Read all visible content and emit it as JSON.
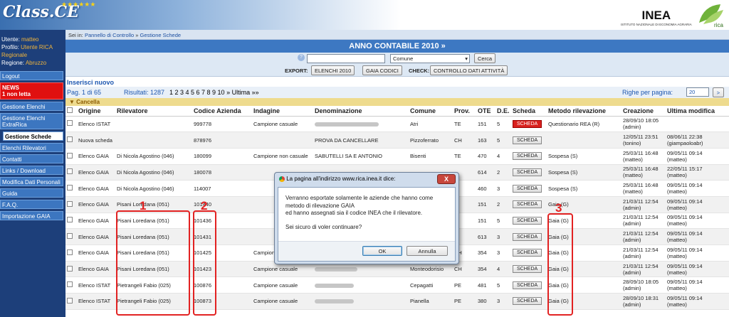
{
  "header": {
    "logo": "Class.CE",
    "inea": "INEA",
    "inea_sub": "ISTITUTO NAZIONALE DI ECONOMIA AGRARIA",
    "rica": "rica"
  },
  "user": {
    "utente_label": "Utente:",
    "utente": "matteo",
    "profilo_label": "Profilo:",
    "profilo": "Utente RICA Regionale",
    "regione_label": "Regione:",
    "regione": "Abruzzo"
  },
  "sidebar": {
    "logout": "Logout",
    "news": "NEWS",
    "news_count": "1 non letta",
    "items": [
      "Gestione Elenchi",
      "Gestione Elenchi ExtraRica",
      "Gestione Schede",
      "Elenchi Rilevatori",
      "Contatti",
      "Links / Download",
      "Modifica Dati Personali",
      "Guida",
      "F.A.Q.",
      "Importazione GAIA"
    ]
  },
  "breadcrumb": {
    "prefix": "Sei in:",
    "home": "Pannello di Controllo",
    "sep": "»",
    "current": "Gestione Schede"
  },
  "page_title": "ANNO CONTABILE 2010 »",
  "search": {
    "help": "?",
    "select_value": "Comune",
    "button": "Cerca"
  },
  "export": {
    "label": "EXPORT:",
    "elenchi": "ELENCHI 2010",
    "gaia": "GAIA CODICI",
    "check_label": "CHECK:",
    "controllo": "CONTROLLO DATI ATTIVITÀ"
  },
  "insert_new": "Inserisci nuovo",
  "pager": {
    "page": "Pag. 1 di 65",
    "results": "Risultati: 1287",
    "pages": "1 2 3 4 5 6 7 8 9 10 » Ultima »»",
    "rows_label": "Righe per pagina:",
    "rows_value": "20",
    "go": ">"
  },
  "cancel": "▼ Cancella",
  "table": {
    "headers": [
      "",
      "Origine",
      "Rilevatore",
      "Codice Azienda",
      "Indagine",
      "Denominazione",
      "Comune",
      "Prov.",
      "OTE",
      "D.E.",
      "Scheda",
      "Metodo rilevazione",
      "Creazione",
      "Ultima modifica"
    ],
    "rows": [
      {
        "origine": "Elenco ISTAT",
        "rilevatore": "",
        "codice": "999778",
        "indagine": "Campione casuale",
        "denominazione": "",
        "comune": "Atri",
        "prov": "TE",
        "ote": "151",
        "de": "5",
        "scheda": "SCHEDA",
        "scheda_red": true,
        "metodo": "Questionario REA (R)",
        "creazione": "28/09/10 18:05",
        "creazione2": "(admin)",
        "modifica": "",
        "modifica2": ""
      },
      {
        "origine": "Nuova scheda",
        "rilevatore": "",
        "codice": "878976",
        "indagine": "",
        "denominazione": "PROVA DA CANCELLARE",
        "comune": "Pizzoferrato",
        "prov": "CH",
        "ote": "163",
        "de": "5",
        "scheda": "SCHEDA",
        "scheda_red": false,
        "metodo": "",
        "creazione": "12/05/11 23:51",
        "creazione2": "(tonino)",
        "modifica": "08/06/11 22:38",
        "modifica2": "(giampaoloabr)"
      },
      {
        "origine": "Elenco GAIA",
        "rilevatore": "Di Nicola Agostino (046)",
        "codice": "180099",
        "indagine": "Campione non casuale",
        "denominazione": "SABUTELLI SA E ANTONIO",
        "comune": "Bisenti",
        "prov": "TE",
        "ote": "470",
        "de": "4",
        "scheda": "SCHEDA",
        "scheda_red": false,
        "metodo": "Sospesa (S)",
        "creazione": "25/03/11 16:48",
        "creazione2": "(matteo)",
        "modifica": "09/05/11 09:14",
        "modifica2": "(matteo)"
      },
      {
        "origine": "Elenco GAIA",
        "rilevatore": "Di Nicola Agostino (046)",
        "codice": "180078",
        "indagine": "",
        "denominazione": "",
        "comune": "",
        "prov": "",
        "ote": "614",
        "de": "2",
        "scheda": "SCHEDA",
        "scheda_red": false,
        "metodo": "Sospesa (S)",
        "creazione": "25/03/11 16:48",
        "creazione2": "(matteo)",
        "modifica": "22/05/11 15:17",
        "modifica2": "(matteo)"
      },
      {
        "origine": "Elenco GAIA",
        "rilevatore": "Di Nicola Agostino (046)",
        "codice": "114007",
        "indagine": "",
        "denominazione": "",
        "comune": "",
        "prov": "",
        "ote": "460",
        "de": "3",
        "scheda": "SCHEDA",
        "scheda_red": false,
        "metodo": "Sospesa (S)",
        "creazione": "25/03/11 16:48",
        "creazione2": "(matteo)",
        "modifica": "09/05/11 09:14",
        "modifica2": "(matteo)"
      },
      {
        "origine": "Elenco GAIA",
        "rilevatore": "Pisani Loredana (051)",
        "codice": "101440",
        "indagine": "",
        "denominazione": "",
        "comune": "",
        "prov": "",
        "ote": "151",
        "de": "2",
        "scheda": "SCHEDA",
        "scheda_red": false,
        "metodo": "Gaia (G)",
        "creazione": "21/03/11 12:54",
        "creazione2": "(admin)",
        "modifica": "09/05/11 09:14",
        "modifica2": "(matteo)"
      },
      {
        "origine": "Elenco GAIA",
        "rilevatore": "Pisani Loredana (051)",
        "codice": "101436",
        "indagine": "",
        "denominazione": "",
        "comune": "",
        "prov": "",
        "ote": "151",
        "de": "5",
        "scheda": "SCHEDA",
        "scheda_red": false,
        "metodo": "Gaia (G)",
        "creazione": "21/03/11 12:54",
        "creazione2": "(admin)",
        "modifica": "09/05/11 09:14",
        "modifica2": "(matteo)"
      },
      {
        "origine": "Elenco GAIA",
        "rilevatore": "Pisani Loredana (051)",
        "codice": "101431",
        "indagine": "",
        "denominazione": "",
        "comune": "",
        "prov": "",
        "ote": "613",
        "de": "3",
        "scheda": "SCHEDA",
        "scheda_red": false,
        "metodo": "Gaia (G)",
        "creazione": "21/03/11 12:54",
        "creazione2": "(admin)",
        "modifica": "09/05/11 09:14",
        "modifica2": "(matteo)"
      },
      {
        "origine": "Elenco GAIA",
        "rilevatore": "Pisani Loredana (051)",
        "codice": "101425",
        "indagine": "Campione casuale",
        "denominazione": "",
        "comune": "",
        "prov": "CH",
        "ote": "354",
        "de": "3",
        "scheda": "SCHEDA",
        "scheda_red": false,
        "metodo": "Gaia (G)",
        "creazione": "21/03/11 12:54",
        "creazione2": "(admin)",
        "modifica": "09/05/11 09:14",
        "modifica2": "(matteo)"
      },
      {
        "origine": "Elenco GAIA",
        "rilevatore": "Pisani Loredana (051)",
        "codice": "101423",
        "indagine": "Campione casuale",
        "denominazione": "",
        "comune": "Monteodorisio",
        "prov": "CH",
        "ote": "354",
        "de": "4",
        "scheda": "SCHEDA",
        "scheda_red": false,
        "metodo": "Gaia (G)",
        "creazione": "21/03/11 12:54",
        "creazione2": "(admin)",
        "modifica": "09/05/11 09:14",
        "modifica2": "(matteo)"
      },
      {
        "origine": "Elenco ISTAT",
        "rilevatore": "Pietrangeli Fabio (025)",
        "codice": "100876",
        "indagine": "Campione casuale",
        "denominazione": "",
        "comune": "Cepagatti",
        "prov": "PE",
        "ote": "481",
        "de": "5",
        "scheda": "SCHEDA",
        "scheda_red": false,
        "metodo": "Gaia (G)",
        "creazione": "28/09/10 18:05",
        "creazione2": "(admin)",
        "modifica": "09/05/11 09:14",
        "modifica2": "(matteo)"
      },
      {
        "origine": "Elenco ISTAT",
        "rilevatore": "Pietrangeli Fabio (025)",
        "codice": "100873",
        "indagine": "Campione casuale",
        "denominazione": "",
        "comune": "Pianella",
        "prov": "PE",
        "ote": "380",
        "de": "3",
        "scheda": "SCHEDA",
        "scheda_red": false,
        "metodo": "Gaia (G)",
        "creazione": "28/09/10 18:31",
        "creazione2": "(admin)",
        "modifica": "09/05/11 09:14",
        "modifica2": "(matteo)"
      }
    ]
  },
  "annotations": {
    "n1": "1",
    "n2": "2",
    "n3": "3"
  },
  "dialog": {
    "title": "La pagina all'indirizzo www.rica.inea.it dice:",
    "close": "X",
    "line1": "Verranno esportate solamente le aziende che hanno come",
    "line2": "metodo di rilevazione GAIA",
    "line3": "ed hanno assegnati sia il codice INEA che il rilevatore.",
    "line4": "Sei sicuro di voler continuare?",
    "ok": "OK",
    "cancel": "Annulla"
  }
}
